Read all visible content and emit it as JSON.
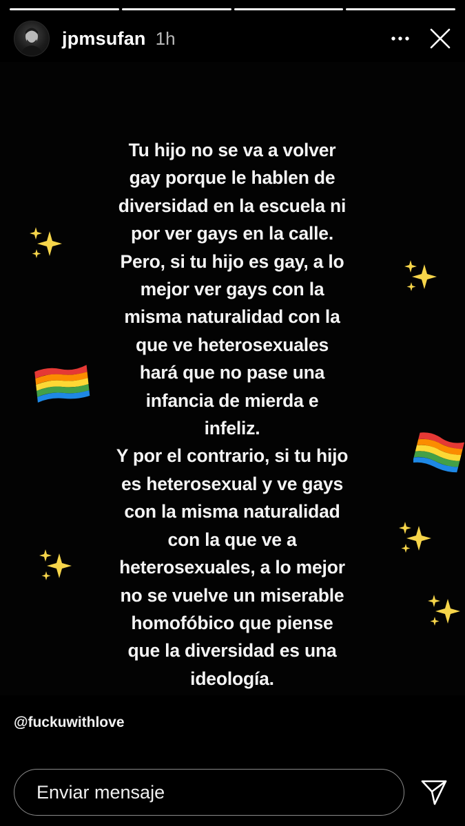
{
  "progress": {
    "segments": [
      {
        "fill": 1
      },
      {
        "fill": 1
      },
      {
        "fill": 1
      },
      {
        "fill": 1
      }
    ]
  },
  "header": {
    "username": "jpmsufan",
    "time": "1h",
    "more_icon": "more-horizontal-icon",
    "close_icon": "close-icon"
  },
  "story": {
    "lines": [
      "Tu hijo no se va a volver",
      "gay porque le hablen de",
      "diversidad en la escuela ni",
      "por ver gays en la calle.",
      "Pero, si tu hijo es gay, a lo",
      "mejor ver gays con la",
      "misma naturalidad con la",
      "que ve heterosexuales",
      "hará que no pase una",
      "infancia de mierda e",
      "infeliz.",
      "Y por el contrario, si tu hijo",
      "es heterosexual y ve gays",
      "con la misma naturalidad",
      "con la que ve a",
      "heterosexuales, a lo mejor",
      "no se vuelve un miserable",
      "homofóbico que piense",
      "que la diversidad es una",
      "ideología."
    ],
    "decorations": [
      "sparkles-icon",
      "rainbow-flag-icon"
    ]
  },
  "mention": "@fuckuwithlove",
  "footer": {
    "message_placeholder": "Enviar mensaje",
    "send_icon": "send-icon"
  },
  "colors": {
    "background": "#000000",
    "text": "#f4f4f4",
    "sparkle": "#f6d54a"
  }
}
